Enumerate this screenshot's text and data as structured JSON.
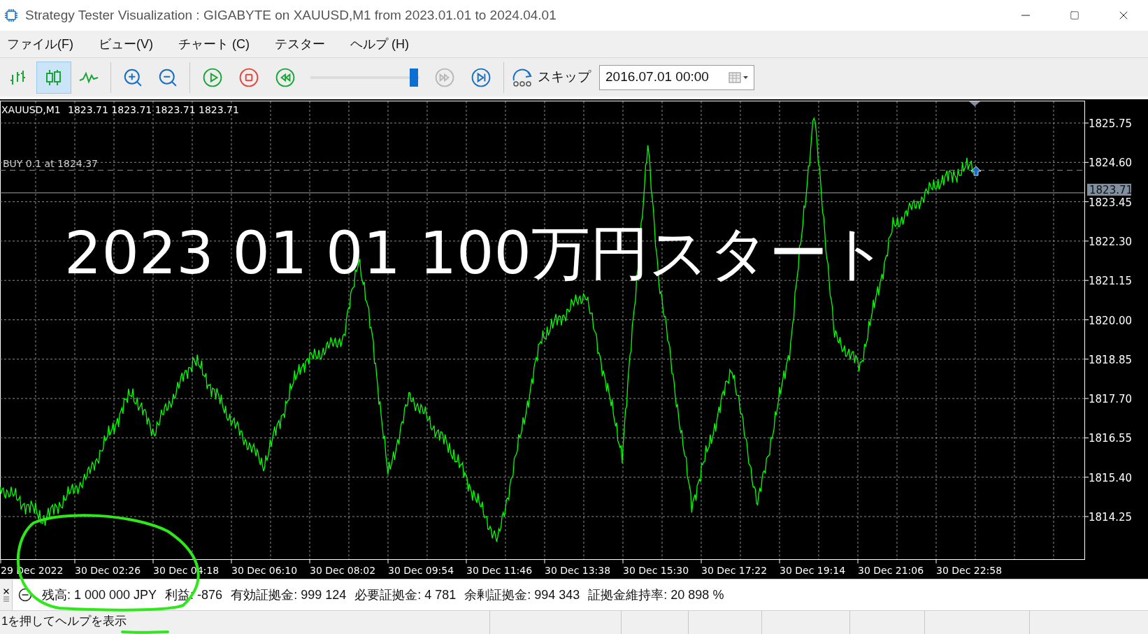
{
  "window": {
    "title": "Strategy Tester Visualization : GIGABYTE on XAUUSD,M1 from 2023.01.01 to 2024.04.01"
  },
  "menu": [
    "ファイル(F)",
    "ビュー(V)",
    "チャート (C)",
    "テスター",
    "ヘルプ (H)"
  ],
  "toolbar": {
    "chart_modes": [
      {
        "kind": "bars",
        "selected": false
      },
      {
        "kind": "candles",
        "selected": true
      },
      {
        "kind": "line",
        "selected": false
      }
    ],
    "zoom": [
      {
        "kind": "zoom-in"
      },
      {
        "kind": "zoom-out"
      }
    ],
    "playback": [
      {
        "kind": "play",
        "disabled": false
      },
      {
        "kind": "stop",
        "disabled": false
      },
      {
        "kind": "rewind",
        "disabled": false
      }
    ],
    "speed": {
      "level": 0.95
    },
    "after_slider": [
      {
        "kind": "fast-forward",
        "disabled": true
      },
      {
        "kind": "skip-end",
        "disabled": false
      }
    ],
    "skip": {
      "label": "スキップ"
    },
    "date_field": {
      "value": "2016.07.01 00:00"
    }
  },
  "chart": {
    "symbol": "XAUUSD,M1",
    "ohlc": "1823.71 1823.71 1823.71 1823.71",
    "order_label": "BUY 0.1 at 1824.37",
    "current_price": "1823.71",
    "price_ticks": [
      "1825.75",
      "1824.60",
      "1823.45",
      "1822.30",
      "1821.15",
      "1820.00",
      "1818.85",
      "1817.70",
      "1816.55",
      "1815.40",
      "1814.25"
    ],
    "time_labels": [
      "29 Dec 2022",
      "30 Dec 02:26",
      "30 Dec 04:18",
      "30 Dec 06:10",
      "30 Dec 08:02",
      "30 Dec 09:54",
      "30 Dec 11:46",
      "30 Dec 13:38",
      "30 Dec 15:30",
      "30 Dec 17:22",
      "30 Dec 19:14",
      "30 Dec 21:06",
      "30 Dec 22:58"
    ],
    "overlay_text": "2023 01 01 100万円スタート"
  },
  "account": [
    "残高: 1 000 000 JPY",
    "利益: -876",
    "有効証拠金: 999 124",
    "必要証拠金: 4 781",
    "余剰証拠金: 994 343",
    "証拠金維持率: 20 898 %"
  ],
  "status_bar": {
    "text": "1を押してヘルプを表示"
  }
}
